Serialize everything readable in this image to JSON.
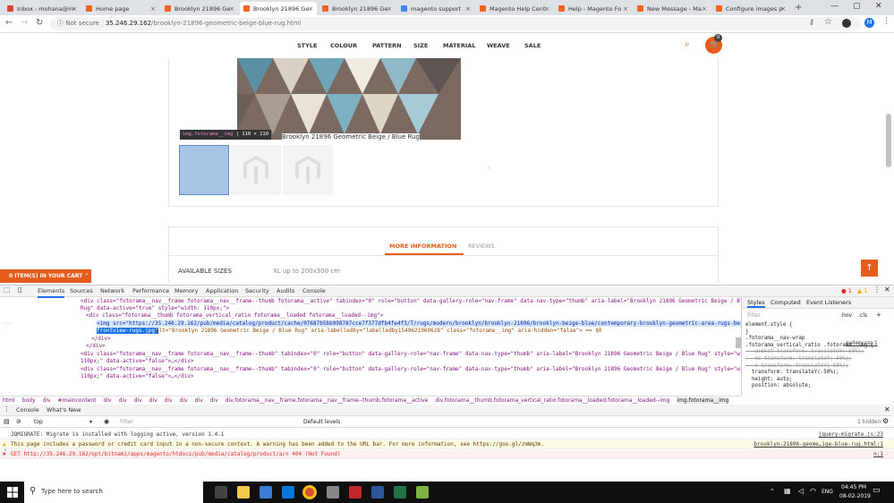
{
  "browser": {
    "tabs": [
      {
        "label": "Inbox - mohana@in",
        "color": "#d44638"
      },
      {
        "label": "Home page",
        "color": "#f26322"
      },
      {
        "label": "Brooklyn 21896 Ge",
        "color": "#f26322"
      },
      {
        "label": "Brooklyn 21896 Ge",
        "color": "#f26322",
        "active": true
      },
      {
        "label": "Brooklyn 21896 Ge",
        "color": "#f26322"
      },
      {
        "label": "magento support",
        "color": "#4285f4"
      },
      {
        "label": "Magento Help Cent",
        "color": "#f26322"
      },
      {
        "label": "Help - Magento Fo",
        "color": "#f26322"
      },
      {
        "label": "New Message - Ma",
        "color": "#f26322"
      },
      {
        "label": "Configure images p",
        "color": "#f26322"
      }
    ],
    "not_secure": "Not secure",
    "url_host": "35.246.29.162",
    "url_path": "/brooklyn-21896-geometric-beige-blue-rug.html",
    "profile_initial": "M"
  },
  "site": {
    "nav": [
      "STYLE",
      "COLOUR",
      "PATTERN",
      "SIZE",
      "MATERIAL",
      "WEAVE",
      "SALE"
    ],
    "cart_count": "0",
    "tooltip_tag": "img.fotorama__img",
    "tooltip_size": "110 × 110",
    "caption": "Brooklyn 21896 Geometric Beige / Blue Rug",
    "tab_more": "MORE INFORMATION",
    "tab_reviews": "REVIEWS",
    "sizes_label": "AVAILABLE SIZES",
    "sizes_value": "XL up to 200x300 cm",
    "cart_bar": "0 ITEM(S) IN YOUR CART"
  },
  "devtools": {
    "tabs": [
      "Elements",
      "Sources",
      "Network",
      "Performance",
      "Memory",
      "Application",
      "Security",
      "Audits",
      "Console"
    ],
    "errors": "1",
    "warnings": "1",
    "code_lines": [
      "<div class=\"fotorama__nav__frame fotorama__nav__frame--thumb fotorama__active\" tabindex=\"0\" role=\"button\" data-gallery-role=\"nav-frame\" data-nav-type=\"thumb\" aria-label=\"Brooklyn 21896 Geometric Beige / Blue",
      "Rug\" data-active=\"true\" style=\"width: 110px;\">",
      "<div class=\"fotorama__thumb fotorama_vertical_ratio fotorama__loaded fotorama__loaded--img\">"
    ],
    "selected_line1": "<img src=\"https://35.246.29.162/pub/media/catalog/product/cache/07687b5bb998787cce7f377dfb4fe4f3/T/rugs/modern/brooklyn/brooklyn-21896/brooklyn-beige-blue/contemporary-brooklyn-geometric-area-rugs-beige-blue-",
    "selected_line2": "frontview-rugs.jpg\"",
    "selected_rest": " alt=\"Brooklyn 21896 Geometric Beige / Blue Rug\" aria-labelledby=\"labelledby1549621969628\" class=\"fotorama__img\" aria-hidden=\"false\"> == $0",
    "code_after": [
      "</div>",
      "</div>",
      "<div class=\"fotorama__nav__frame fotorama__nav__frame--thumb\" tabindex=\"0\" role=\"button\" data-gallery-role=\"nav-frame\" data-nav-type=\"thumb\" aria-label=\"Brooklyn 21896 Geometric Beige / Blue Rug\" style=\"width:",
      "110px;\" data-active=\"false\">…</div>",
      "<div class=\"fotorama__nav__frame fotorama__nav__frame--thumb\" tabindex=\"0\" role=\"button\" data-gallery-role=\"nav-frame\" data-nav-type=\"thumb\" aria-label=\"Brooklyn 21896 Geometric Beige / Blue Rug\" style=\"width:",
      "110px;\" data-active=\"false\">…</div>"
    ],
    "breadcrumb": [
      "html",
      "body",
      "div",
      "#maincontent",
      "div",
      "div",
      "div",
      "div",
      "div",
      "div",
      "div",
      "div",
      "div.fotorama__nav__frame.fotorama__nav__frame--thumb.fotorama__active",
      "div.fotorama__thumb.fotorama_vertical_ratio.fotorama__loaded.fotorama__loaded--img",
      "img.fotorama__img"
    ],
    "styles_tabs": [
      "Styles",
      "Computed",
      "Event Listeners"
    ],
    "filter": "Filter",
    "hov": ":hov",
    "cls": ".cls",
    "styles_lines": [
      "element.style {",
      "}",
      ".fotorama__nav-wrap",
      ".fotorama_vertical_ratio .fotorama__img {",
      "  -webkit-transform: translateY(-50%);",
      "  -ms-transform: translateY(-50%);",
      "  -o-transform: translateY(-50%);",
      "  transform: translateY(-50%);",
      "  height: auto;",
      "  position: absolute;"
    ],
    "styles_source": "gallery.css:1",
    "drawer_tabs": [
      "Console",
      "What's New"
    ],
    "context": "top",
    "console_filter": "Filter",
    "levels": "Default levels",
    "hidden": "1 hidden",
    "console": [
      {
        "text": "JQMIGRATE: Migrate is installed with logging active, version 1.4.1",
        "src": "jquery-migrate.js:23",
        "type": "log"
      },
      {
        "text": "This page includes a password or credit card input in a non-secure context. A warning has been added to the URL bar. For more information, see https://goo.gl/zmWq3m.",
        "src": "brooklyn-21896-geome…ige-blue-rug.html:1",
        "type": "warn"
      },
      {
        "text": "GET http://35.246.29.162/opt/bitnami/apps/magento/htdocs/pub/media/catalog/product/a/n 404 (Not Found)",
        "src": "n:1",
        "type": "error"
      }
    ]
  },
  "taskbar": {
    "search": "Type here to search",
    "time": "04:45 PM",
    "date": "08-02-2019",
    "lang": "ENG"
  }
}
